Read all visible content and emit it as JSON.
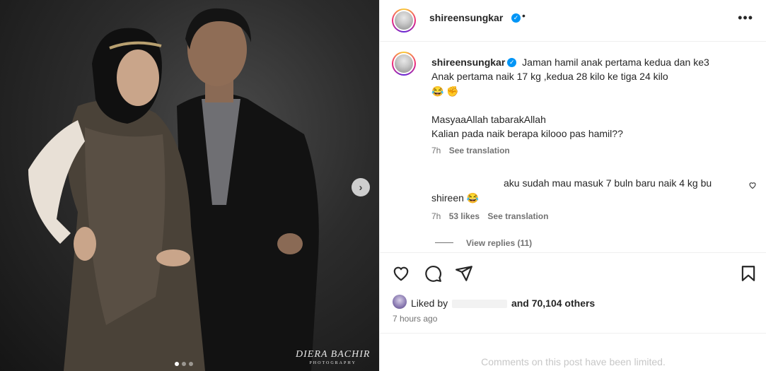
{
  "post": {
    "username": "shireensungkar",
    "separator": "•",
    "more_icon": "more-horizontal-icon",
    "watermark_main": "DIERA BACHIR",
    "watermark_sub": "PHOTOGRAPHY",
    "carousel_next_icon": "chevron-right-icon"
  },
  "caption": {
    "username": "shireensungkar",
    "line1": "Jaman hamil anak pertama kedua dan ke3",
    "line2": "Anak pertama naik 17 kg ,kedua 28 kilo ke tiga 24 kilo",
    "emoji": "😂 ✊",
    "line3": "MasyaaAllah tabarakAllah",
    "line4": "Kalian pada naik berapa kilooo pas hamil??",
    "time": "7h",
    "see_translation": "See translation"
  },
  "comment": {
    "text_line1": "aku sudah mau masuk 7 buln baru naik 4 kg bu",
    "text_line2": "shireen 😂",
    "time": "7h",
    "likes": "53 likes",
    "see_translation": "See translation",
    "view_replies": "View replies (11)"
  },
  "actions": {
    "liked_by": "Liked by",
    "and_others": "and 70,104 others",
    "time_ago": "7 hours ago",
    "limited_notice": "Comments on this post have been limited."
  },
  "colors": {
    "verified": "#0095f6",
    "muted": "#737373",
    "text": "#262626"
  }
}
